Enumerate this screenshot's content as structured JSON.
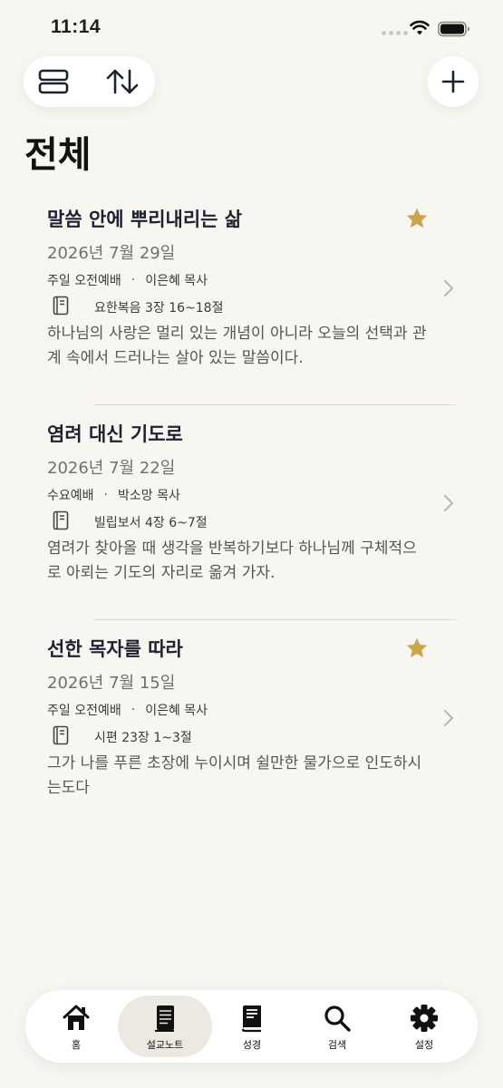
{
  "status_bar": {
    "time": "11:14"
  },
  "toolbar": {
    "layout_icon": "rows-layout-icon",
    "sort_icon": "sort-arrows-icon",
    "add_icon": "plus-icon"
  },
  "page": {
    "title": "전체"
  },
  "notes": [
    {
      "title": "말씀 안에 뿌리내리는 삶",
      "starred": true,
      "date": "2026년 7월 29일",
      "service": "주일 오전예배",
      "separator": "·",
      "preacher": "이은혜 목사",
      "scripture": "요한복음 3장 16~18절",
      "summary": "하나님의 사랑은 멀리 있는 개념이 아니라 오늘의 선택과 관계 속에서 드러나는 살아 있는 말씀이다."
    },
    {
      "title": "염려 대신 기도로",
      "starred": false,
      "date": "2026년 7월 22일",
      "service": "수요예배",
      "separator": "·",
      "preacher": "박소망 목사",
      "scripture": "빌립보서 4장 6~7절",
      "summary": "염려가 찾아올 때 생각을 반복하기보다 하나님께 구체적으로 아뢰는 기도의 자리로 옮겨 가자."
    },
    {
      "title": "선한 목자를 따라",
      "starred": true,
      "date": "2026년 7월 15일",
      "service": "주일 오전예배",
      "separator": "·",
      "preacher": "이은혜 목사",
      "scripture": "시편 23장 1~3절",
      "summary": "그가 나를 푸른 초장에 누이시며 쉴만한 물가으로 인도하시는도다"
    }
  ],
  "colors": {
    "background": "#f8f6f1",
    "star": "#c9a54e",
    "active_tab": "#ece9e2"
  },
  "tab_bar": {
    "active_index": 1,
    "tabs": [
      {
        "label": "홈",
        "icon": "home-icon"
      },
      {
        "label": "설교노트",
        "icon": "notebook-icon"
      },
      {
        "label": "성경",
        "icon": "bible-icon"
      },
      {
        "label": "검색",
        "icon": "search-icon"
      },
      {
        "label": "설정",
        "icon": "gear-icon"
      }
    ]
  }
}
